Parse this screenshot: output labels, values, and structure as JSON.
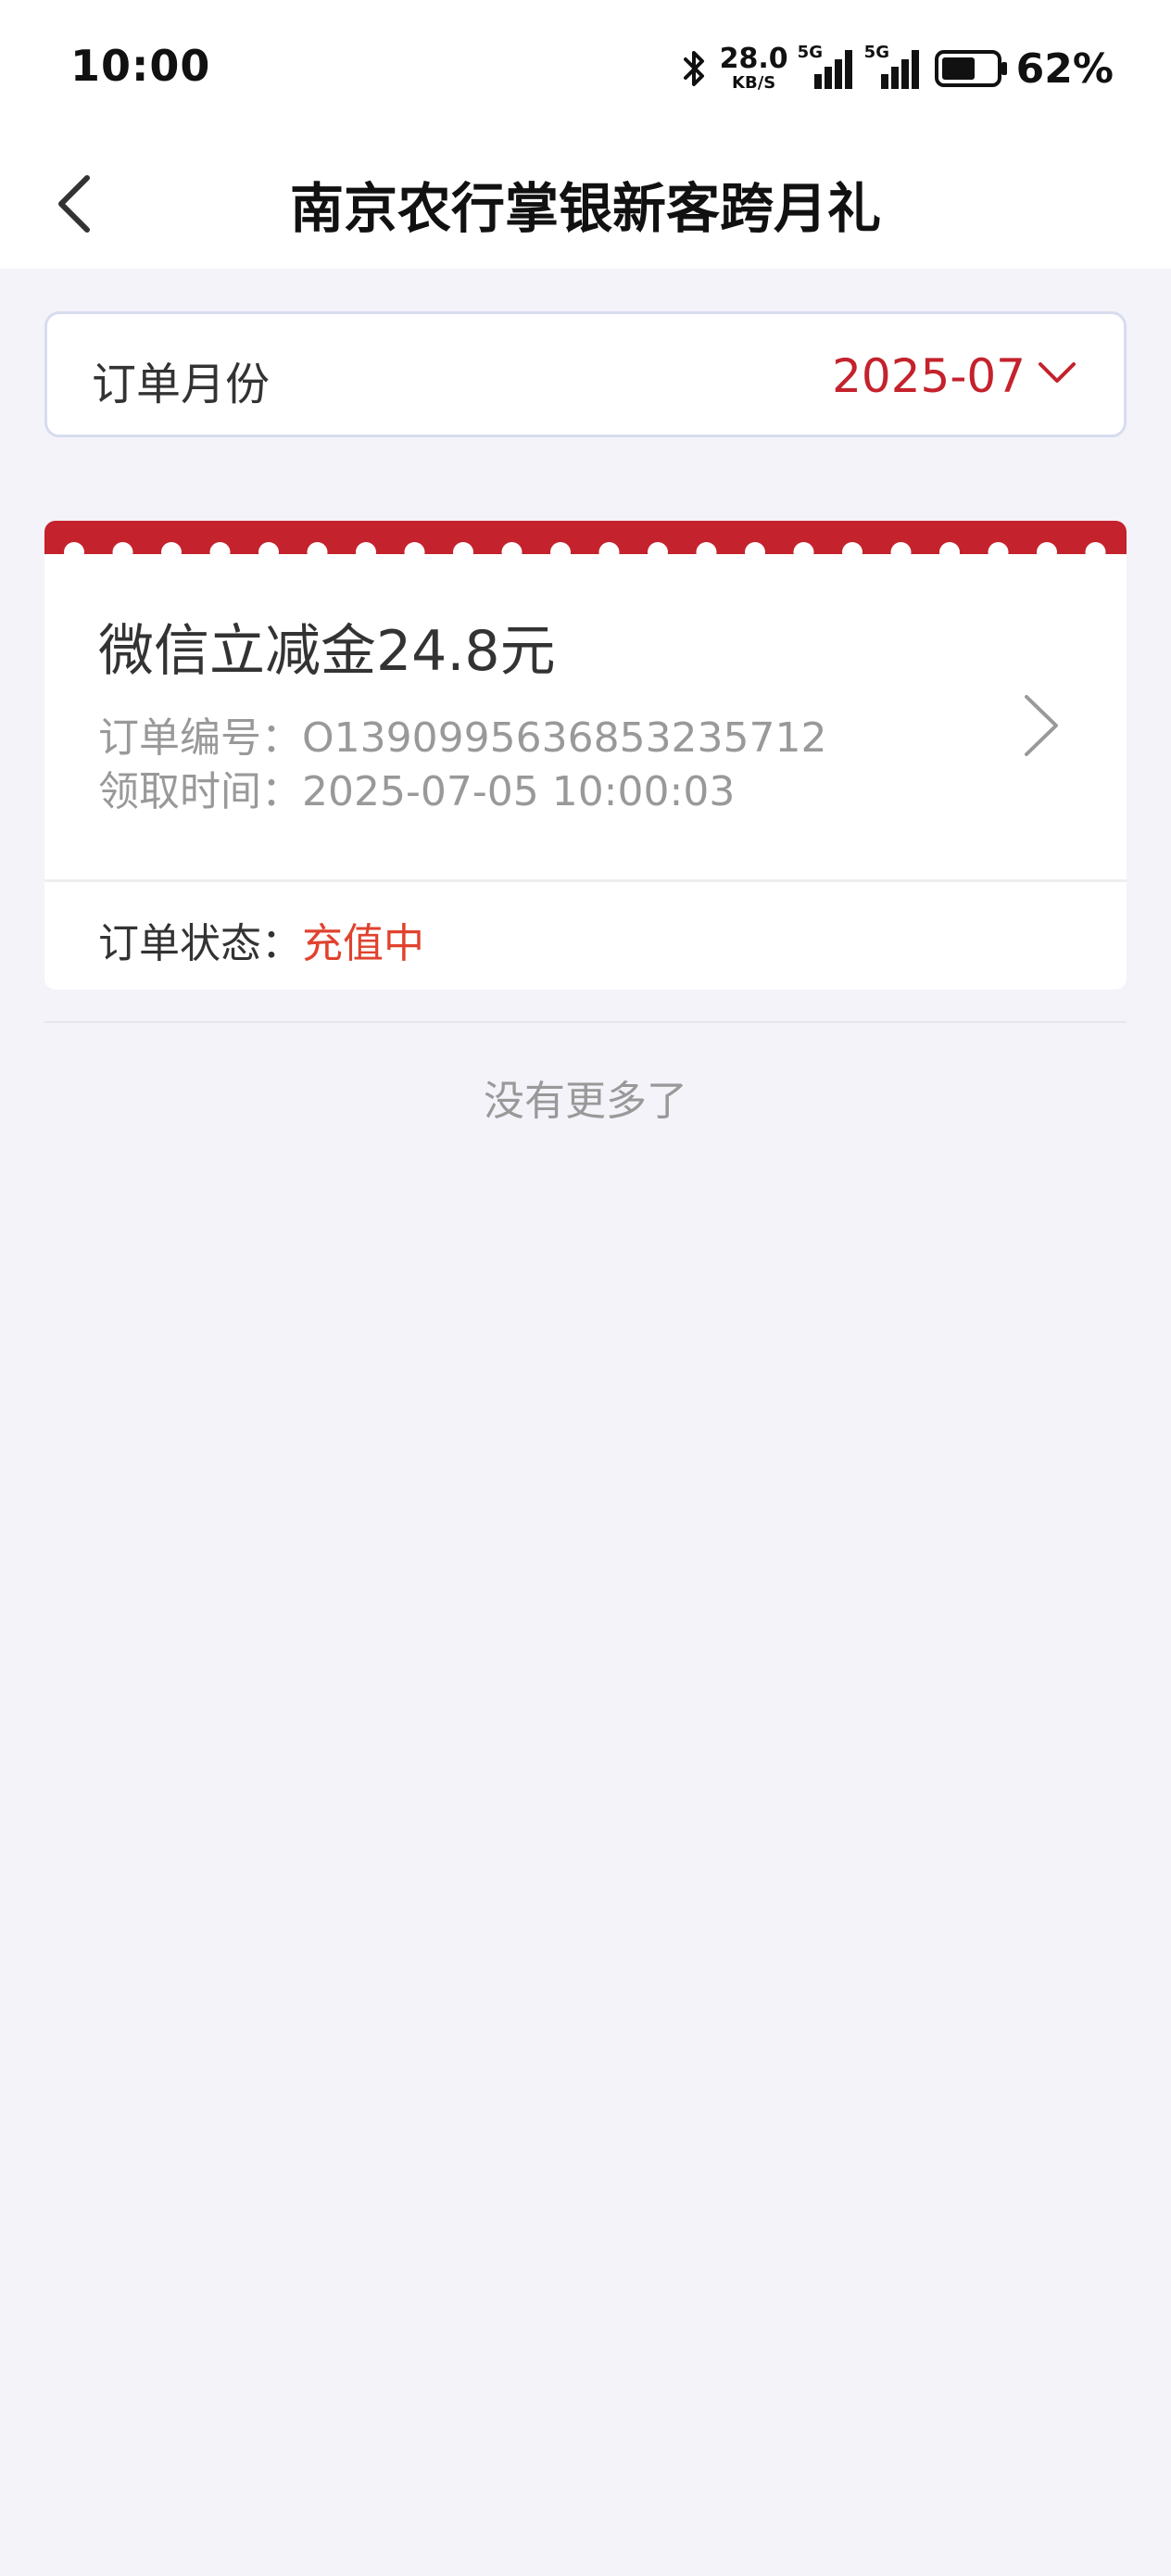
{
  "status_bar": {
    "time": "10:00",
    "speed_value": "28.0",
    "speed_unit": "KB/S",
    "signal1_label": "5G",
    "signal2_label": "5G",
    "battery_percent": "62%",
    "battery_level": 0.62
  },
  "header": {
    "title": "南京农行掌银新客跨月礼"
  },
  "month_filter": {
    "label": "订单月份",
    "value": "2025-07"
  },
  "orders": [
    {
      "title": "微信立减金24.8元",
      "order_number_label": "订单编号：",
      "order_number": "O1390995636853235712",
      "received_time_label": "领取时间：",
      "received_time": "2025-07-05 10:00:03",
      "status_label": "订单状态：",
      "status": "充值中"
    }
  ],
  "list_footer": "没有更多了",
  "colors": {
    "accent_red": "#c4222c",
    "status_red": "#e0422e",
    "background": "#f3f3f9"
  }
}
